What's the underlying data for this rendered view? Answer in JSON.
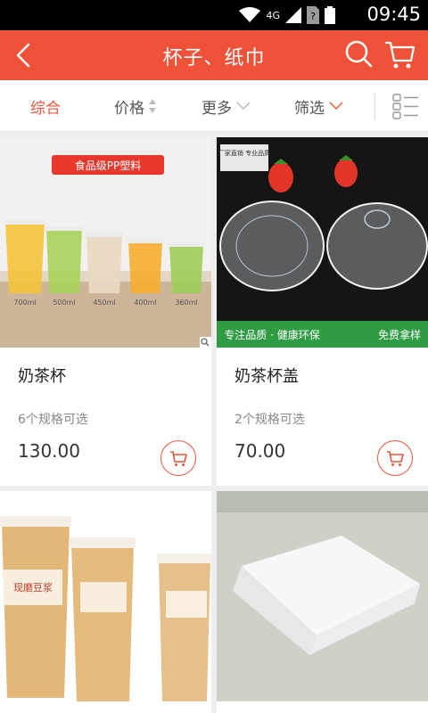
{
  "status_bar": {
    "time": "09:45",
    "network": "4G"
  },
  "header": {
    "title": "杯子、纸巾"
  },
  "filters": [
    {
      "label": "综合"
    },
    {
      "label": "价格"
    },
    {
      "label": "更多"
    },
    {
      "label": "筛选"
    }
  ],
  "image_texts": {
    "badge1": "食品级PP塑料",
    "volumes": [
      "700ml",
      "500ml",
      "450ml",
      "400ml",
      "360ml"
    ],
    "banner2_left": "专注品质 · 健康环保",
    "banner2_right": "免费拿样",
    "tag2": "厂家直销 专业品质",
    "cup_brand": "现磨豆浆"
  },
  "products": [
    {
      "name": "奶茶杯",
      "specs": "6个规格可选",
      "price": "130.00"
    },
    {
      "name": "奶茶杯盖",
      "specs": "2个规格可选",
      "price": "70.00"
    },
    {
      "name": "",
      "specs": "",
      "price": ""
    },
    {
      "name": "",
      "specs": "",
      "price": ""
    }
  ],
  "colors": {
    "accent": "#ee5339",
    "background": "#eeeeee"
  }
}
